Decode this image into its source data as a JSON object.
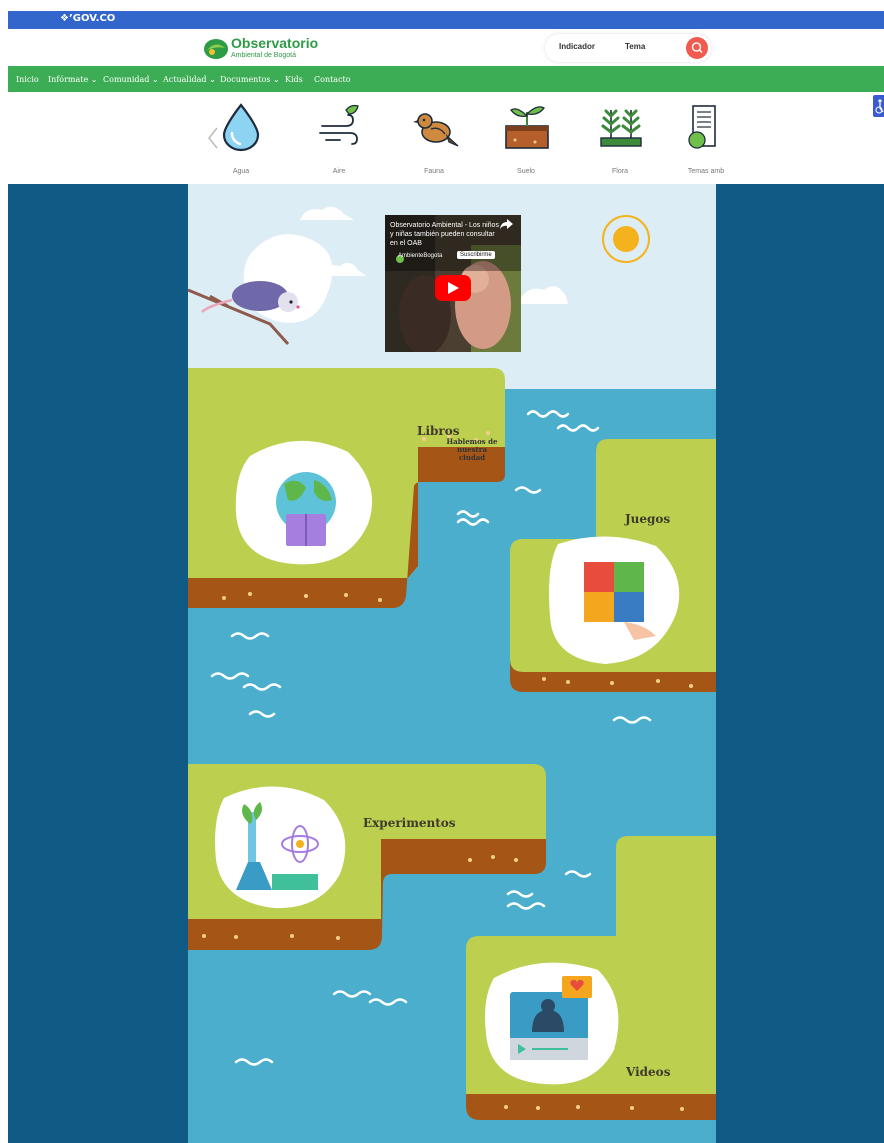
{
  "gov_bar": {
    "label": "GOV.CO"
  },
  "logo": {
    "title": "Observatorio",
    "subtitle": "Ambiental de Bogotá"
  },
  "search": {
    "indicator_label": "Indicador",
    "theme_label": "Tema"
  },
  "nav": {
    "items": [
      "Inicio",
      "Infórmate",
      "Comunidad",
      "Actualidad",
      "Documentos",
      "Kids",
      "Contacto"
    ]
  },
  "categories": [
    {
      "label": "Agua",
      "icon": "water-drop-icon"
    },
    {
      "label": "Aire",
      "icon": "wind-icon"
    },
    {
      "label": "Fauna",
      "icon": "bird-icon"
    },
    {
      "label": "Suelo",
      "icon": "soil-sprout-icon"
    },
    {
      "label": "Flora",
      "icon": "plants-icon"
    },
    {
      "label": "Temas amb",
      "icon": "document-leaf-icon"
    }
  ],
  "kids": {
    "speech": "Hablemos de nuestra ciudad",
    "video": {
      "title": "Observatorio Ambiental - Los niños y niñas también pueden consultar en el OAB",
      "channel": "AmbienteBogota",
      "subscribe": "Suscribirme"
    },
    "sections": {
      "books": "Libros",
      "games": "Juegos",
      "experiments": "Experimentos",
      "videos": "Videos"
    }
  },
  "colors": {
    "gov_blue": "#3366cc",
    "nav_green": "#3dad55",
    "page_navy": "#0f5b85",
    "sky": "#ddedf5",
    "river": "#4aaecc",
    "grass": "#bccf4f",
    "soil": "#a55516",
    "search_red": "#f05a4f"
  }
}
